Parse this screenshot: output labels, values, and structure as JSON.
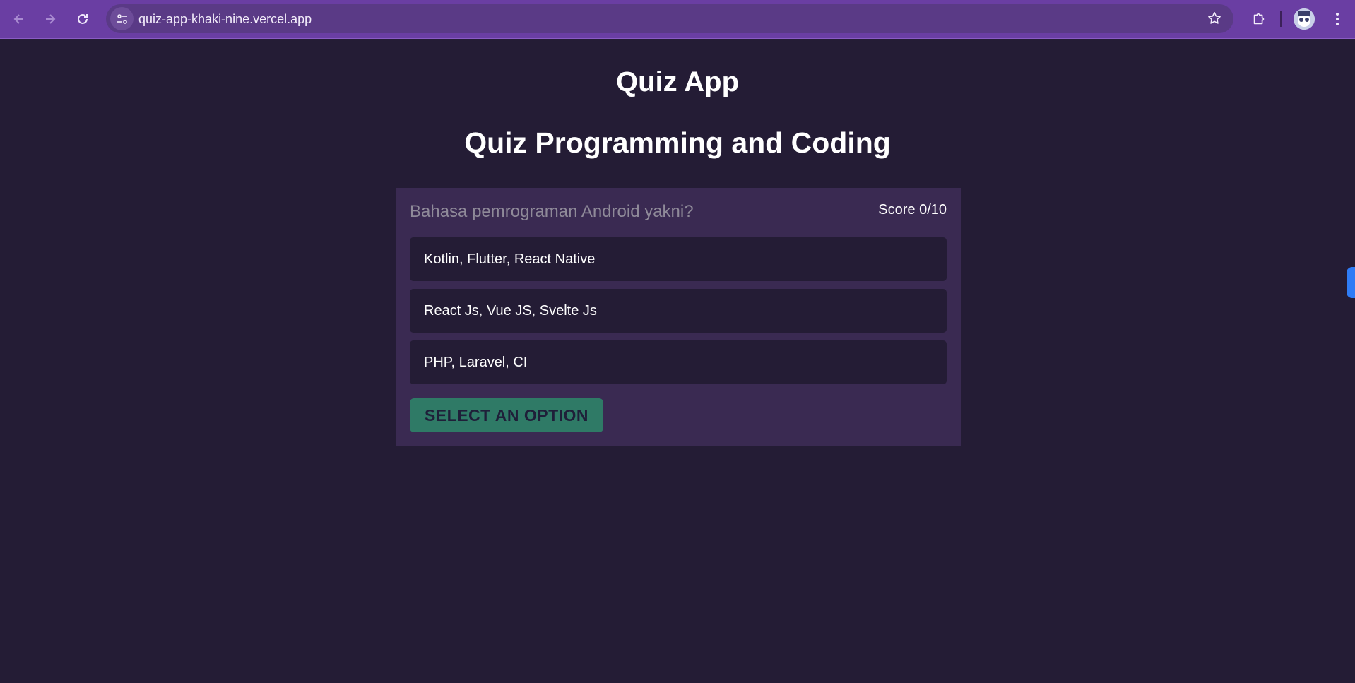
{
  "browser": {
    "url": "quiz-app-khaki-nine.vercel.app",
    "icons": {
      "back": "arrow-left-icon",
      "forward": "arrow-right-icon",
      "reload": "reload-icon",
      "site_info": "tune-icon",
      "bookmark": "star-icon",
      "extensions": "puzzle-icon",
      "menu": "kebab-menu-icon"
    },
    "accent_color": "#6a3ea3"
  },
  "page": {
    "app_title": "Quiz App",
    "quiz_title": "Quiz Programming and Coding"
  },
  "quiz": {
    "question": "Bahasa pemrograman Android yakni?",
    "score": "Score 0/10",
    "options": [
      {
        "label": "Kotlin, Flutter, React Native"
      },
      {
        "label": "React Js, Vue JS, Svelte Js"
      },
      {
        "label": "PHP, Laravel, CI"
      }
    ],
    "submit_label": "SELECT AN OPTION"
  },
  "colors": {
    "background": "#241c35",
    "card": "#3a2a52",
    "button": "#2f7a66"
  }
}
